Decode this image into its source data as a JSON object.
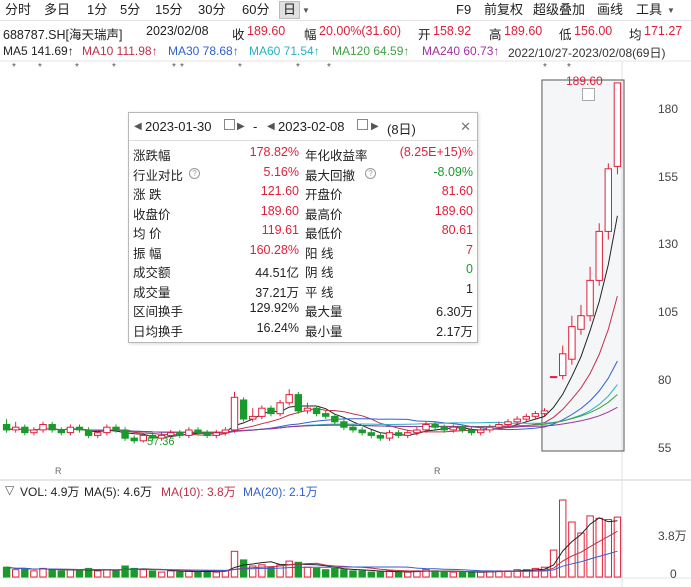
{
  "toolbar": {
    "items": [
      "分时",
      "多日",
      "1分",
      "5分",
      "15分",
      "30分",
      "60分",
      "日"
    ],
    "right": [
      "F9",
      "前复权",
      "超级叠加",
      "画线",
      "工具"
    ],
    "dropdown_icon": "chevron-down-icon"
  },
  "info": {
    "code": "688787.SH[海天瑞声]",
    "date": "2023/02/08",
    "close_label": "收",
    "close": "189.60",
    "change_label": "幅",
    "change": "20.00%(31.60)",
    "open_label": "开",
    "open": "158.92",
    "high_label": "高",
    "high": "189.60",
    "low_label": "低",
    "low": "156.00",
    "avg_label": "均",
    "avg": "171.27"
  },
  "ma": {
    "ma5": "MA5 141.69↑",
    "ma10": "MA10 111.98↑",
    "ma30": "MA30 78.68↑",
    "ma60": "MA60 71.54↑",
    "ma120": "MA120 64.59↑",
    "ma240": "MA240 60.73↑",
    "range": "2022/10/27-2023/02/08(69日)"
  },
  "colors": {
    "up": "#e0203a",
    "down": "#1a9a2a",
    "ma5": "#222222",
    "ma10": "#c03048",
    "ma30": "#3060d0",
    "ma60": "#28b0c8",
    "ma120": "#40a040",
    "ma240": "#a030a0"
  },
  "chart": {
    "price_ticks": [
      "180",
      "155",
      "130",
      "105",
      "80",
      "55"
    ],
    "max_label": "189.60",
    "min_label": "57.36",
    "vol_ticks": [
      "3.8万",
      "0"
    ],
    "r_markers": [
      "R",
      "R"
    ]
  },
  "popup": {
    "start_date": "2023-01-30",
    "dash": "-",
    "end_date": "2023-02-08",
    "days": "(8日)",
    "rows": [
      {
        "l1": "涨跌幅",
        "v1": "178.82%",
        "c1": "red",
        "l2": "年化收益率",
        "v2": "(8.25E+15)%",
        "c2": "red"
      },
      {
        "l1": "行业对比",
        "v1": "5.16%",
        "c1": "red",
        "l2": "最大回撤",
        "v2": "-8.09%",
        "c2": "green"
      },
      {
        "l1": "涨  跌",
        "v1": "121.60",
        "c1": "red",
        "l2": "开盘价",
        "v2": "81.60",
        "c2": "red"
      },
      {
        "l1": "收盘价",
        "v1": "189.60",
        "c1": "red",
        "l2": "最高价",
        "v2": "189.60",
        "c2": "red"
      },
      {
        "l1": "均  价",
        "v1": "119.61",
        "c1": "red",
        "l2": "最低价",
        "v2": "80.61",
        "c2": "red"
      },
      {
        "l1": "振  幅",
        "v1": "160.28%",
        "c1": "red",
        "l2": "阳  线",
        "v2": "7",
        "c2": "red"
      },
      {
        "l1": "成交额",
        "v1": "44.51亿",
        "c1": "black",
        "l2": "阴  线",
        "v2": "0",
        "c2": "green"
      },
      {
        "l1": "成交量",
        "v1": "37.21万",
        "c1": "black",
        "l2": "平  线",
        "v2": "1",
        "c2": "black"
      },
      {
        "l1": "区间换手",
        "v1": "129.92%",
        "c1": "black",
        "l2": "最大量",
        "v2": "6.30万",
        "c2": "black"
      },
      {
        "l1": "日均换手",
        "v1": "16.24%",
        "c1": "black",
        "l2": "最小量",
        "v2": "2.17万",
        "c2": "black"
      }
    ]
  },
  "volume": {
    "menu": "▽",
    "vol": "VOL: 4.9万",
    "ma5": "MA(5): 4.6万",
    "ma10": "MA(10): 3.8万",
    "ma20": "MA(20): 2.1万"
  },
  "candles": [
    {
      "o": 64,
      "c": 62,
      "h": 66,
      "l": 61,
      "v": 0.8
    },
    {
      "o": 62,
      "c": 63,
      "h": 65,
      "l": 61,
      "v": 0.6
    },
    {
      "o": 63,
      "c": 61,
      "h": 64,
      "l": 60,
      "v": 0.7
    },
    {
      "o": 61,
      "c": 62,
      "h": 63,
      "l": 60,
      "v": 0.5
    },
    {
      "o": 62,
      "c": 64,
      "h": 65,
      "l": 61,
      "v": 0.7
    },
    {
      "o": 64,
      "c": 62,
      "h": 65,
      "l": 61,
      "v": 0.6
    },
    {
      "o": 62,
      "c": 61,
      "h": 63,
      "l": 60,
      "v": 0.5
    },
    {
      "o": 61,
      "c": 63,
      "h": 64,
      "l": 60,
      "v": 0.6
    },
    {
      "o": 63,
      "c": 62,
      "h": 64,
      "l": 61,
      "v": 0.5
    },
    {
      "o": 62,
      "c": 60,
      "h": 63,
      "l": 59,
      "v": 0.7
    },
    {
      "o": 60,
      "c": 61,
      "h": 62,
      "l": 59,
      "v": 0.5
    },
    {
      "o": 61,
      "c": 63,
      "h": 64,
      "l": 60,
      "v": 0.6
    },
    {
      "o": 63,
      "c": 62,
      "h": 64,
      "l": 61,
      "v": 0.5
    },
    {
      "o": 62,
      "c": 59,
      "h": 63,
      "l": 58,
      "v": 0.9
    },
    {
      "o": 59,
      "c": 58,
      "h": 60,
      "l": 57,
      "v": 0.7
    },
    {
      "o": 58,
      "c": 60,
      "h": 61,
      "l": 57.4,
      "v": 0.6
    },
    {
      "o": 60,
      "c": 59,
      "h": 61,
      "l": 58,
      "v": 0.5
    },
    {
      "o": 59,
      "c": 60,
      "h": 61,
      "l": 58,
      "v": 0.4
    },
    {
      "o": 60,
      "c": 61,
      "h": 62,
      "l": 59,
      "v": 0.5
    },
    {
      "o": 61,
      "c": 60,
      "h": 62,
      "l": 59,
      "v": 0.4
    },
    {
      "o": 60,
      "c": 62,
      "h": 63,
      "l": 59,
      "v": 0.5
    },
    {
      "o": 62,
      "c": 61,
      "h": 63,
      "l": 60,
      "v": 0.4
    },
    {
      "o": 61,
      "c": 60,
      "h": 62,
      "l": 59,
      "v": 0.5
    },
    {
      "o": 60,
      "c": 61,
      "h": 62,
      "l": 59,
      "v": 0.4
    },
    {
      "o": 61,
      "c": 62,
      "h": 63,
      "l": 60,
      "v": 0.5
    },
    {
      "o": 62,
      "c": 74,
      "h": 76,
      "l": 61,
      "v": 2.1
    },
    {
      "o": 73,
      "c": 66,
      "h": 74,
      "l": 65,
      "v": 1.4
    },
    {
      "o": 66,
      "c": 67,
      "h": 70,
      "l": 65,
      "v": 0.9
    },
    {
      "o": 67,
      "c": 70,
      "h": 71,
      "l": 66,
      "v": 1.0
    },
    {
      "o": 70,
      "c": 68,
      "h": 71,
      "l": 67,
      "v": 0.8
    },
    {
      "o": 68,
      "c": 72,
      "h": 73,
      "l": 67,
      "v": 1.0
    },
    {
      "o": 72,
      "c": 75,
      "h": 77,
      "l": 71,
      "v": 1.3
    },
    {
      "o": 75,
      "c": 69,
      "h": 76,
      "l": 68,
      "v": 1.2
    },
    {
      "o": 69,
      "c": 70,
      "h": 72,
      "l": 68,
      "v": 0.8
    },
    {
      "o": 70,
      "c": 68,
      "h": 71,
      "l": 67,
      "v": 0.7
    },
    {
      "o": 68,
      "c": 67,
      "h": 69,
      "l": 66,
      "v": 0.6
    },
    {
      "o": 67,
      "c": 65,
      "h": 68,
      "l": 64,
      "v": 0.7
    },
    {
      "o": 65,
      "c": 63,
      "h": 66,
      "l": 62,
      "v": 0.6
    },
    {
      "o": 63,
      "c": 62,
      "h": 64,
      "l": 61,
      "v": 0.5
    },
    {
      "o": 62,
      "c": 61,
      "h": 63,
      "l": 60,
      "v": 0.5
    },
    {
      "o": 61,
      "c": 60,
      "h": 62,
      "l": 59,
      "v": 0.4
    },
    {
      "o": 60,
      "c": 59,
      "h": 61,
      "l": 58,
      "v": 0.4
    },
    {
      "o": 59,
      "c": 61,
      "h": 62,
      "l": 58,
      "v": 0.5
    },
    {
      "o": 61,
      "c": 60,
      "h": 62,
      "l": 59,
      "v": 0.4
    },
    {
      "o": 60,
      "c": 61,
      "h": 62,
      "l": 59,
      "v": 0.4
    },
    {
      "o": 61,
      "c": 62,
      "h": 63,
      "l": 60,
      "v": 0.5
    },
    {
      "o": 62,
      "c": 64,
      "h": 65,
      "l": 61,
      "v": 0.6
    },
    {
      "o": 64,
      "c": 63,
      "h": 65,
      "l": 62,
      "v": 0.5
    },
    {
      "o": 63,
      "c": 62,
      "h": 64,
      "l": 61,
      "v": 0.4
    },
    {
      "o": 62,
      "c": 63,
      "h": 64,
      "l": 61,
      "v": 0.4
    },
    {
      "o": 63,
      "c": 62,
      "h": 64,
      "l": 61,
      "v": 0.4
    },
    {
      "o": 62,
      "c": 61,
      "h": 63,
      "l": 60,
      "v": 0.4
    },
    {
      "o": 61,
      "c": 62,
      "h": 63,
      "l": 60,
      "v": 0.4
    },
    {
      "o": 62,
      "c": 63,
      "h": 64,
      "l": 61,
      "v": 0.5
    },
    {
      "o": 63,
      "c": 64,
      "h": 65,
      "l": 62,
      "v": 0.5
    },
    {
      "o": 64,
      "c": 65,
      "h": 66,
      "l": 63,
      "v": 0.5
    },
    {
      "o": 65,
      "c": 66,
      "h": 67,
      "l": 64,
      "v": 0.6
    },
    {
      "o": 66,
      "c": 67,
      "h": 68,
      "l": 65,
      "v": 0.6
    },
    {
      "o": 67,
      "c": 68,
      "h": 69,
      "l": 66,
      "v": 0.7
    },
    {
      "o": 68,
      "c": 69,
      "h": 70,
      "l": 67,
      "v": 0.8
    },
    {
      "o": 81.6,
      "c": 81.6,
      "h": 81.6,
      "l": 81.6,
      "v": 2.2
    },
    {
      "o": 82,
      "c": 90,
      "h": 93,
      "l": 80.6,
      "v": 6.3
    },
    {
      "o": 88,
      "c": 100,
      "h": 104,
      "l": 86,
      "v": 4.5
    },
    {
      "o": 99,
      "c": 104,
      "h": 108,
      "l": 97,
      "v": 3.6
    },
    {
      "o": 104,
      "c": 117,
      "h": 122,
      "l": 102,
      "v": 5.0
    },
    {
      "o": 117,
      "c": 135,
      "h": 138,
      "l": 115,
      "v": 4.8
    },
    {
      "o": 135,
      "c": 158,
      "h": 160,
      "l": 132,
      "v": 4.7
    },
    {
      "o": 158.9,
      "c": 189.6,
      "h": 189.6,
      "l": 156,
      "v": 4.9
    }
  ]
}
